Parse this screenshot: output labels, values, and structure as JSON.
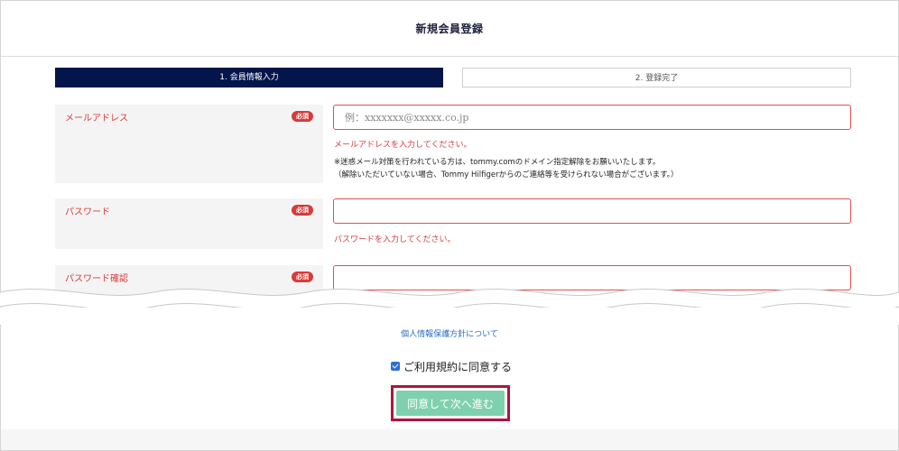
{
  "header": {
    "title": "新規会員登録"
  },
  "steps": [
    {
      "label": "1. 会員情報入力",
      "active": true
    },
    {
      "label": "2. 登録完了",
      "active": false
    }
  ],
  "fields": {
    "email": {
      "label": "メールアドレス",
      "required": "必須",
      "placeholder": "例：xxxxxxx@xxxxx.co.jp",
      "error": "メールアドレスを入力してください。",
      "note_line1": "※迷惑メール対策を行われている方は、tommy.comのドメイン指定解除をお願いいたします。",
      "note_line2": "（解除いただいていない場合、Tommy Hilfigerからのご連絡等を受けられない場合がございます。）"
    },
    "password": {
      "label": "パスワード",
      "required": "必須",
      "error": "パスワードを入力してください。"
    },
    "password_confirm": {
      "label": "パスワード確認",
      "required": "必須"
    }
  },
  "privacy_link": "個人情報保護方針について",
  "agree": {
    "label": "ご利用規約に同意する",
    "checked": true
  },
  "submit_label": "同意して次へ進む",
  "colors": {
    "navy": "#03154b",
    "error": "#d93a3a",
    "submit": "#7fd1ad",
    "highlight": "#b0143c",
    "link": "#2b6cc4"
  }
}
